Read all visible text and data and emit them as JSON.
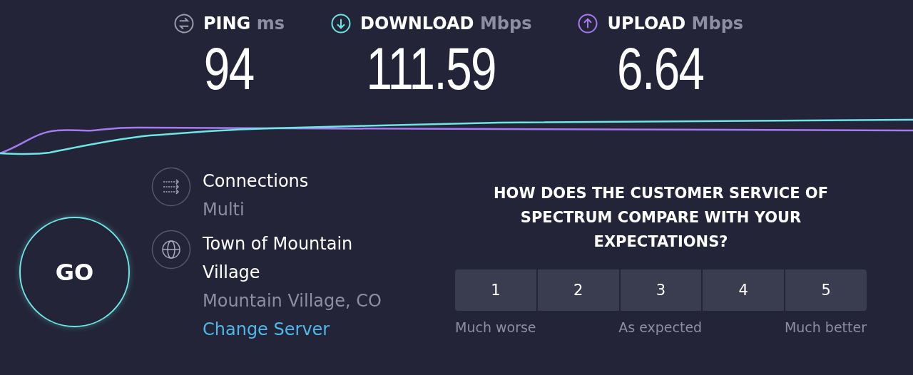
{
  "metrics": [
    {
      "kind": "ping",
      "label": "PING",
      "unit": "ms",
      "value": "94"
    },
    {
      "kind": "download",
      "label": "DOWNLOAD",
      "unit": "Mbps",
      "value": "111.59"
    },
    {
      "kind": "upload",
      "label": "UPLOAD",
      "unit": "Mbps",
      "value": "6.64"
    }
  ],
  "go_button": {
    "label": "GO"
  },
  "connections": {
    "title": "Connections",
    "value": "Multi"
  },
  "server": {
    "name": "Town of Mountain Village",
    "location": "Mountain Village, CO",
    "link": "Change Server"
  },
  "survey": {
    "question": "HOW DOES THE CUSTOMER SERVICE OF SPECTRUM COMPARE WITH YOUR EXPECTATIONS?",
    "options": [
      {
        "label": "1",
        "selected": false
      },
      {
        "label": "2",
        "selected": false
      },
      {
        "label": "3",
        "selected": false
      },
      {
        "label": "4",
        "selected": false
      },
      {
        "label": "5",
        "selected": false
      }
    ],
    "scale_labels": [
      "Much worse",
      "As expected",
      "Much better"
    ]
  }
}
